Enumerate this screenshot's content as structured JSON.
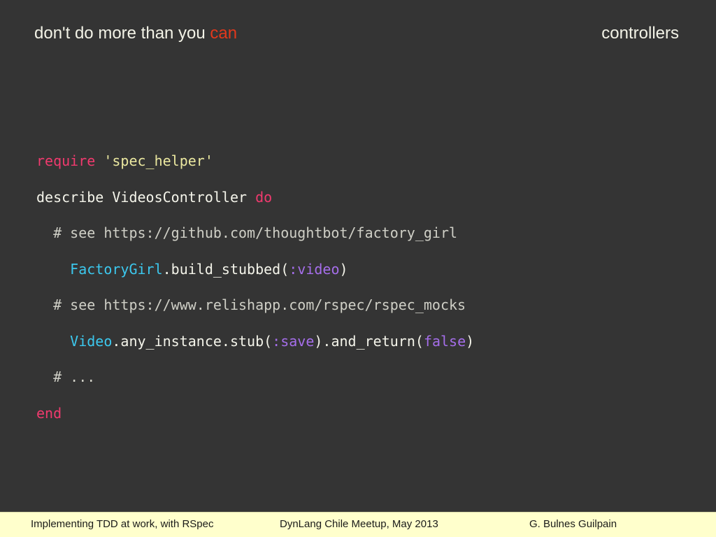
{
  "header": {
    "title_prefix": "don't do more than you ",
    "title_accent": "can",
    "section": "controllers"
  },
  "code": {
    "line1": {
      "kw": "require",
      "sp": " ",
      "str": "'spec_helper'"
    },
    "line2": {
      "text": "describe VideosController ",
      "kw": "do"
    },
    "line3": {
      "text": "  # see https://github.com/thoughtbot/factory_girl"
    },
    "line4": {
      "indent": "    ",
      "cls": "FactoryGirl",
      "mid": ".build_stubbed(",
      "sym": ":video",
      "end": ")"
    },
    "line5": {
      "text": "  # see https://www.relishapp.com/rspec/rspec_mocks"
    },
    "line6": {
      "indent": "    ",
      "cls": "Video",
      "mid": ".any_instance.stub(",
      "sym": ":save",
      "mid2": ").and_return(",
      "sym2": "false",
      "end": ")"
    },
    "line7": {
      "text": "  # ..."
    },
    "line8": {
      "kw": "end"
    }
  },
  "footer": {
    "left": "Implementing TDD at work, with RSpec",
    "center": "DynLang Chile Meetup, May 2013",
    "right": "G. Bulnes Guilpain"
  },
  "colors": {
    "background": "#343434",
    "accent": "#e2381c",
    "keyword": "#f03a6e",
    "string": "#ebe8a0",
    "class": "#3cc8ee",
    "symbol": "#a56eea",
    "footer_bg": "#ffffcc"
  }
}
